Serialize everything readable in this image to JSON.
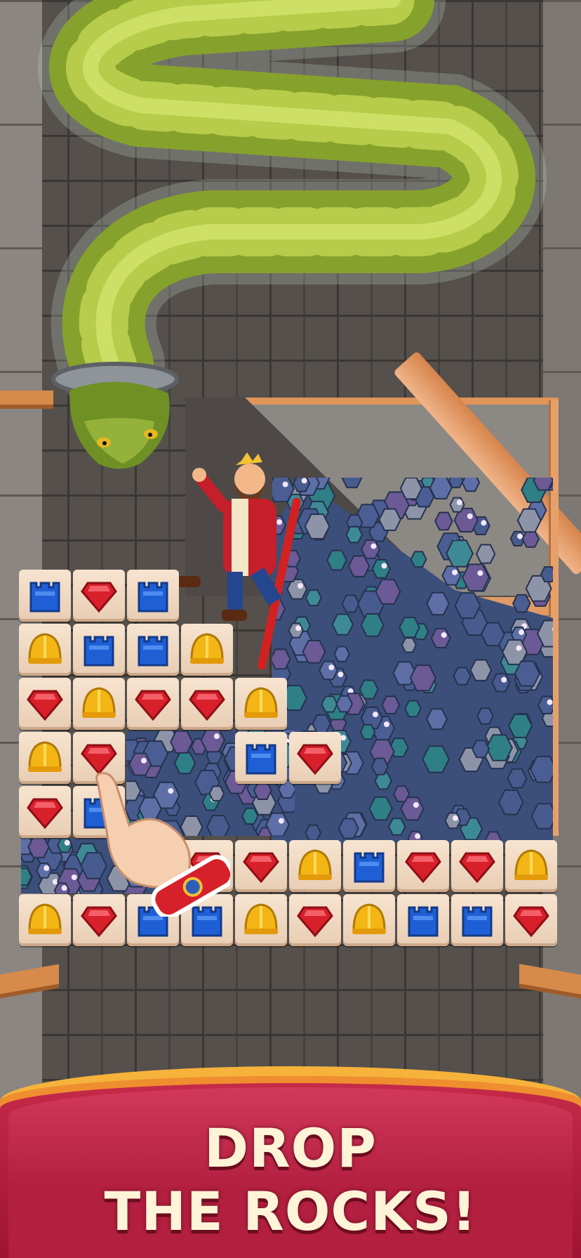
{
  "banner": {
    "line1": "DROP",
    "line2": "THE ROCKS!"
  },
  "colors": {
    "banner_fill": "#b21f3f",
    "banner_border": "#f6b23a",
    "text": "#fff4d8",
    "tile": "#f3ddc6",
    "wall": "#55504c",
    "snake": "#86a22c"
  },
  "board": {
    "rows": [
      [
        "castle",
        "gem",
        "castle",
        null,
        null,
        null,
        null,
        null,
        null,
        null
      ],
      [
        "helmet",
        "castle",
        "castle",
        "helmet",
        null,
        null,
        null,
        null,
        null,
        null
      ],
      [
        "gem",
        "helmet",
        "gem",
        "gem",
        "helmet",
        null,
        null,
        null,
        null,
        null
      ],
      [
        "helmet",
        "gem",
        null,
        null,
        "castle",
        "gem",
        null,
        null,
        null,
        null
      ],
      [
        "gem",
        "castle",
        null,
        null,
        null,
        null,
        null,
        null,
        null,
        null
      ],
      [
        null,
        null,
        null,
        "gem",
        "gem",
        "helmet",
        "castle",
        "gem",
        "gem",
        "helmet"
      ],
      [
        "helmet",
        "gem",
        "castle",
        "castle",
        "helmet",
        "gem",
        "helmet",
        "castle",
        "castle",
        "gem"
      ]
    ]
  },
  "pieces": {
    "castle": "blue-castle-icon",
    "gem": "red-gem-icon",
    "helmet": "gold-helmet-icon"
  }
}
